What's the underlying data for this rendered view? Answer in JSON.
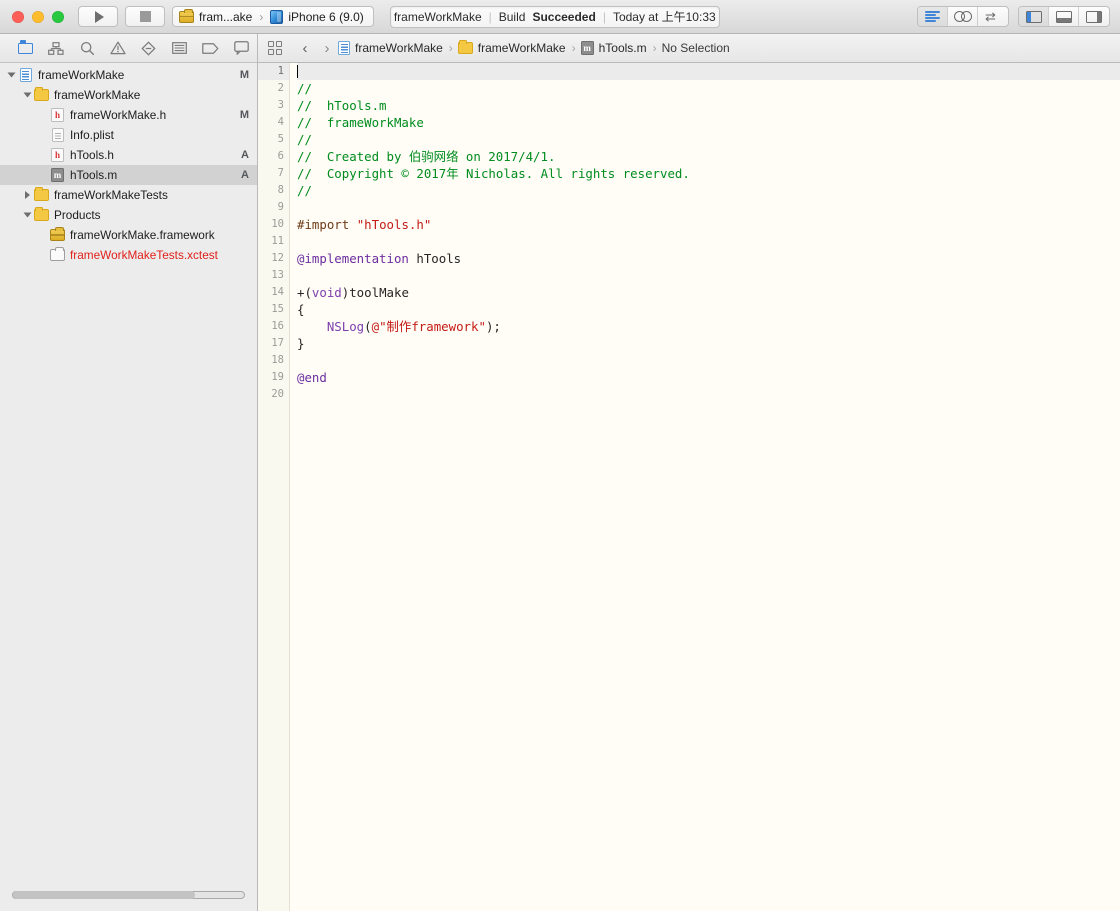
{
  "window": {
    "traffic_lights": [
      "close",
      "minimize",
      "zoom"
    ]
  },
  "toolbar": {
    "run_button": "run",
    "stop_button": "stop",
    "scheme": {
      "project_icon": "toolbox-icon",
      "project_name": "fram...ake",
      "separator": "›",
      "device_icon": "device-icon",
      "destination": "iPhone 6 (9.0)"
    },
    "status": {
      "target": "frameWorkMake",
      "sep1": "|",
      "build_label": "Build",
      "build_result": "Succeeded",
      "sep2": "|",
      "time": "Today at 上午10:33"
    },
    "editor_modes": [
      "standard-editor",
      "assistant-editor",
      "version-editor"
    ],
    "pane_toggles": [
      "navigator-pane",
      "debug-pane",
      "utilities-pane"
    ]
  },
  "navigator": {
    "tabs": [
      {
        "name": "project-navigator",
        "selected": true
      },
      {
        "name": "symbol-navigator",
        "selected": false
      },
      {
        "name": "find-navigator",
        "selected": false
      },
      {
        "name": "issue-navigator",
        "selected": false
      },
      {
        "name": "test-navigator",
        "selected": false
      },
      {
        "name": "debug-navigator",
        "selected": false
      },
      {
        "name": "breakpoint-navigator",
        "selected": false
      },
      {
        "name": "report-navigator",
        "selected": false
      }
    ],
    "tree": [
      {
        "label": "frameWorkMake",
        "icon": "project",
        "indent": 0,
        "twisty": "open",
        "status": "M",
        "selected": false,
        "red": false
      },
      {
        "label": "frameWorkMake",
        "icon": "folder",
        "indent": 1,
        "twisty": "open",
        "status": "",
        "selected": false,
        "red": false
      },
      {
        "label": "frameWorkMake.h",
        "icon": "header",
        "indent": 2,
        "twisty": "none",
        "status": "M",
        "selected": false,
        "red": false
      },
      {
        "label": "Info.plist",
        "icon": "plist",
        "indent": 2,
        "twisty": "none",
        "status": "",
        "selected": false,
        "red": false
      },
      {
        "label": "hTools.h",
        "icon": "header",
        "indent": 2,
        "twisty": "none",
        "status": "A",
        "selected": false,
        "red": false
      },
      {
        "label": "hTools.m",
        "icon": "source",
        "indent": 2,
        "twisty": "none",
        "status": "A",
        "selected": true,
        "red": false
      },
      {
        "label": "frameWorkMakeTests",
        "icon": "folder",
        "indent": 1,
        "twisty": "closed",
        "status": "",
        "selected": false,
        "red": false
      },
      {
        "label": "Products",
        "icon": "folder",
        "indent": 1,
        "twisty": "open",
        "status": "",
        "selected": false,
        "red": false
      },
      {
        "label": "frameWorkMake.framework",
        "icon": "framework",
        "indent": 2,
        "twisty": "none",
        "status": "",
        "selected": false,
        "red": false
      },
      {
        "label": "frameWorkMakeTests.xctest",
        "icon": "xctest",
        "indent": 2,
        "twisty": "none",
        "status": "",
        "selected": false,
        "red": true
      }
    ]
  },
  "jumpbar": {
    "related_items_icon": "grid-icon",
    "back": "‹",
    "forward": "›",
    "crumbs": [
      {
        "label": "frameWorkMake",
        "icon": "project"
      },
      {
        "label": "frameWorkMake",
        "icon": "folder"
      },
      {
        "label": "hTools.m",
        "icon": "source"
      },
      {
        "label": "No Selection",
        "icon": "none"
      }
    ],
    "separator": "›"
  },
  "editor": {
    "filename": "hTools.m",
    "line_numbers": [
      1,
      2,
      3,
      4,
      5,
      6,
      7,
      8,
      9,
      10,
      11,
      12,
      13,
      14,
      15,
      16,
      17,
      18,
      19,
      20
    ],
    "current_line": 1,
    "lines": [
      {
        "n": 1,
        "tokens": [
          {
            "t": "",
            "c": "pl"
          }
        ]
      },
      {
        "n": 2,
        "tokens": [
          {
            "t": "//",
            "c": "cm"
          }
        ]
      },
      {
        "n": 3,
        "tokens": [
          {
            "t": "//  hTools.m",
            "c": "cm"
          }
        ]
      },
      {
        "n": 4,
        "tokens": [
          {
            "t": "//  frameWorkMake",
            "c": "cm"
          }
        ]
      },
      {
        "n": 5,
        "tokens": [
          {
            "t": "//",
            "c": "cm"
          }
        ]
      },
      {
        "n": 6,
        "tokens": [
          {
            "t": "//  Created by 伯驹网络 on 2017/4/1.",
            "c": "cm"
          }
        ]
      },
      {
        "n": 7,
        "tokens": [
          {
            "t": "//  Copyright © 2017年 Nicholas. All rights reserved.",
            "c": "cm"
          }
        ]
      },
      {
        "n": 8,
        "tokens": [
          {
            "t": "//",
            "c": "cm"
          }
        ]
      },
      {
        "n": 9,
        "tokens": [
          {
            "t": "",
            "c": "pl"
          }
        ]
      },
      {
        "n": 10,
        "tokens": [
          {
            "t": "#import ",
            "c": "pre"
          },
          {
            "t": "\"hTools.h\"",
            "c": "str"
          }
        ]
      },
      {
        "n": 11,
        "tokens": [
          {
            "t": "",
            "c": "pl"
          }
        ]
      },
      {
        "n": 12,
        "tokens": [
          {
            "t": "@implementation",
            "c": "kw"
          },
          {
            "t": " hTools",
            "c": "pl"
          }
        ]
      },
      {
        "n": 13,
        "tokens": [
          {
            "t": "",
            "c": "pl"
          }
        ]
      },
      {
        "n": 14,
        "tokens": [
          {
            "t": "+(",
            "c": "pl"
          },
          {
            "t": "void",
            "c": "kw2"
          },
          {
            "t": ")toolMake",
            "c": "pl"
          }
        ]
      },
      {
        "n": 15,
        "tokens": [
          {
            "t": "{",
            "c": "pl"
          }
        ]
      },
      {
        "n": 16,
        "tokens": [
          {
            "t": "    ",
            "c": "pl"
          },
          {
            "t": "NSLog",
            "c": "kw2"
          },
          {
            "t": "(",
            "c": "pl"
          },
          {
            "t": "@\"制作framework\"",
            "c": "str"
          },
          {
            "t": ");",
            "c": "pl"
          }
        ]
      },
      {
        "n": 17,
        "tokens": [
          {
            "t": "}",
            "c": "pl"
          }
        ]
      },
      {
        "n": 18,
        "tokens": [
          {
            "t": "",
            "c": "pl"
          }
        ]
      },
      {
        "n": 19,
        "tokens": [
          {
            "t": "@end",
            "c": "kw"
          }
        ]
      },
      {
        "n": 20,
        "tokens": [
          {
            "t": "",
            "c": "pl"
          }
        ]
      }
    ]
  },
  "colors": {
    "comment": "#008C1F",
    "preprocessor": "#6F3B16",
    "string": "#C41A16",
    "keyword": "#6B2EA0",
    "editor_bg": "#FFFDF5",
    "selection": "#D2D2D2",
    "accent": "#3F86D8",
    "red_label": "#E0201B"
  }
}
